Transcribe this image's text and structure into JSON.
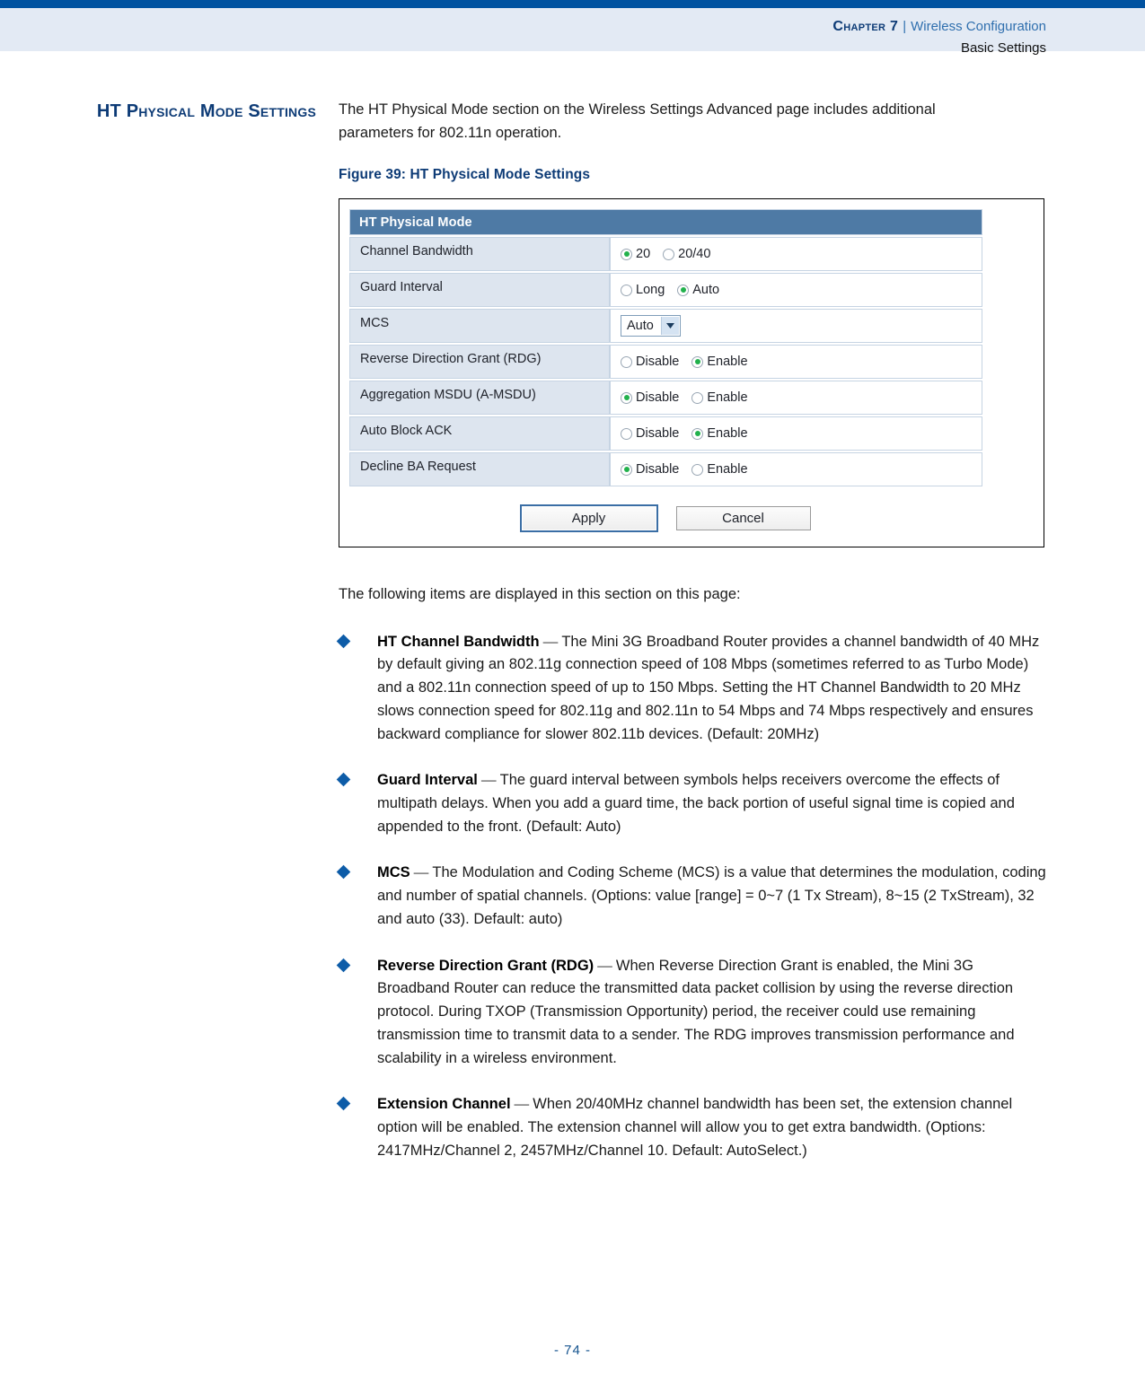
{
  "header": {
    "chapter": "Chapter 7",
    "separator": "|",
    "section": "Wireless Configuration",
    "subsection": "Basic Settings"
  },
  "side_heading": "HT Physical Mode Settings",
  "intro_paragraph": "The HT Physical Mode section on the Wireless Settings Advanced page includes additional parameters for 802.11n operation.",
  "figure": {
    "caption": "Figure 39:  HT Physical Mode Settings",
    "panel_title": "HT Physical Mode",
    "rows": [
      {
        "label": "Channel Bandwidth",
        "type": "radio",
        "options": [
          {
            "label": "20",
            "selected": true
          },
          {
            "label": "20/40",
            "selected": false
          }
        ]
      },
      {
        "label": "Guard Interval",
        "type": "radio",
        "options": [
          {
            "label": "Long",
            "selected": false
          },
          {
            "label": "Auto",
            "selected": true
          }
        ]
      },
      {
        "label": "MCS",
        "type": "select",
        "value": "Auto"
      },
      {
        "label": "Reverse Direction Grant (RDG)",
        "type": "radio",
        "options": [
          {
            "label": "Disable",
            "selected": false
          },
          {
            "label": "Enable",
            "selected": true
          }
        ]
      },
      {
        "label": "Aggregation MSDU (A-MSDU)",
        "type": "radio",
        "options": [
          {
            "label": "Disable",
            "selected": true
          },
          {
            "label": "Enable",
            "selected": false
          }
        ]
      },
      {
        "label": "Auto Block ACK",
        "type": "radio",
        "options": [
          {
            "label": "Disable",
            "selected": false
          },
          {
            "label": "Enable",
            "selected": true
          }
        ]
      },
      {
        "label": "Decline BA Request",
        "type": "radio",
        "options": [
          {
            "label": "Disable",
            "selected": true
          },
          {
            "label": "Enable",
            "selected": false
          }
        ]
      }
    ],
    "buttons": {
      "apply": "Apply",
      "cancel": "Cancel"
    }
  },
  "lead_text": "The following items are displayed in this section on this page:",
  "bullets": [
    {
      "term": "HT Channel Bandwidth",
      "dash": " — ",
      "text": "The Mini 3G Broadband Router provides a channel bandwidth of 40 MHz by default giving an 802.11g connection speed of 108 Mbps (sometimes referred to as Turbo Mode) and a 802.11n connection speed of up to 150 Mbps. Setting the HT Channel Bandwidth to 20 MHz slows connection speed for 802.11g and 802.11n to 54 Mbps and 74 Mbps respectively and ensures backward compliance for slower 802.11b devices. (Default: 20MHz)"
    },
    {
      "term": "Guard Interval",
      "dash": " — ",
      "text": "The guard interval between symbols helps receivers overcome the effects of multipath delays. When you add a guard time, the back portion of useful signal time is copied and appended to the front. (Default: Auto)"
    },
    {
      "term": "MCS",
      "dash": " — ",
      "text": "The Modulation and Coding Scheme (MCS) is a value that determines the modulation, coding and number of spatial channels. (Options: value [range] = 0~7 (1 Tx Stream), 8~15 (2 TxStream), 32 and auto (33). Default: auto)"
    },
    {
      "term": "Reverse Direction Grant (RDG)",
      "dash": " — ",
      "text": "When Reverse Direction Grant is enabled, the Mini 3G Broadband Router can reduce the transmitted data packet collision by using the reverse direction protocol. During TXOP (Transmission Opportunity) period, the receiver could use remaining transmission time to transmit data to a sender. The RDG improves transmission performance and scalability in a wireless environment."
    },
    {
      "term": "Extension Channel",
      "dash": " — ",
      "text": "When 20/40MHz channel bandwidth has been set, the extension channel option will be enabled. The extension channel will allow you to get extra bandwidth. (Options: 2417MHz/Channel 2, 2457MHz/Channel 10. Default: AutoSelect.)"
    }
  ],
  "footer": "-  74  -",
  "colors": {
    "rule_blue": "#0052a0",
    "header_band": "#e3eaf4",
    "heading_blue": "#0d3b76",
    "link_blue": "#2f6fae",
    "panel_header": "#4e7aa5",
    "label_cell": "#dde5ef",
    "radio_fill": "#22b14c",
    "bullet_blue": "#0d5ca8",
    "footer_blue": "#16548f"
  }
}
